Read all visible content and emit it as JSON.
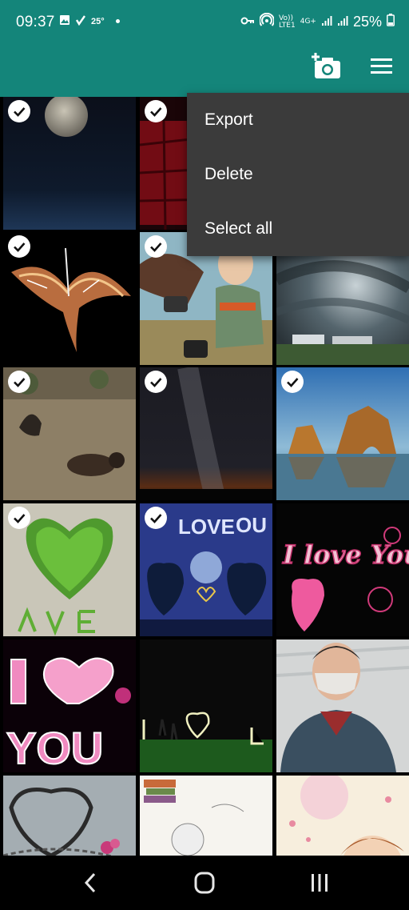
{
  "status_bar": {
    "time": "09:37",
    "temperature": "25°",
    "battery": "25%",
    "volte_label": "Vo))\nLTE1",
    "network_label": "4G+"
  },
  "app_bar": {
    "camera_icon": "add-photo-icon",
    "menu_icon": "hamburger-menu-icon"
  },
  "menu": {
    "items": [
      {
        "label": "Export"
      },
      {
        "label": "Delete"
      },
      {
        "label": "Select all"
      }
    ]
  },
  "thumbnails": {
    "theme_colors": {
      "accent": "#14857a",
      "menu_bg": "#3b3b3b"
    },
    "tiles": [
      {
        "row": 1,
        "col": 1,
        "subject": "moon-night",
        "selected": true
      },
      {
        "row": 1,
        "col": 2,
        "subject": "red-abstract",
        "selected": true
      },
      {
        "row": 1,
        "col": 3,
        "subject": "hidden",
        "selected": false
      },
      {
        "row": 2,
        "col": 1,
        "subject": "fiery-phoenix",
        "selected": true
      },
      {
        "row": 2,
        "col": 2,
        "subject": "anime-warrior",
        "selected": true
      },
      {
        "row": 2,
        "col": 3,
        "subject": "storm-sky",
        "selected": false
      },
      {
        "row": 3,
        "col": 1,
        "subject": "vulture-child",
        "selected": true
      },
      {
        "row": 3,
        "col": 2,
        "subject": "milky-way",
        "selected": true
      },
      {
        "row": 3,
        "col": 3,
        "subject": "sea-arch-rocks",
        "selected": true
      },
      {
        "row": 4,
        "col": 1,
        "subject": "grass-heart",
        "selected": true
      },
      {
        "row": 4,
        "col": 2,
        "subject": "love-you-trees",
        "selected": true
      },
      {
        "row": 4,
        "col": 3,
        "subject": "i-love-you-text",
        "selected": false
      },
      {
        "row": 5,
        "col": 1,
        "subject": "i-love-you-pink",
        "selected": false
      },
      {
        "row": 5,
        "col": 2,
        "subject": "night-heart-lights",
        "selected": false
      },
      {
        "row": 5,
        "col": 3,
        "subject": "masked-person",
        "selected": false
      },
      {
        "row": 6,
        "col": 1,
        "subject": "heart-chain",
        "selected": false
      },
      {
        "row": 6,
        "col": 2,
        "subject": "books-sketch",
        "selected": false
      },
      {
        "row": 6,
        "col": 3,
        "subject": "good-start-art",
        "selected": false
      }
    ]
  },
  "nav_bar": {
    "back_icon": "back-icon",
    "home_icon": "home-icon",
    "recents_icon": "recents-icon"
  }
}
